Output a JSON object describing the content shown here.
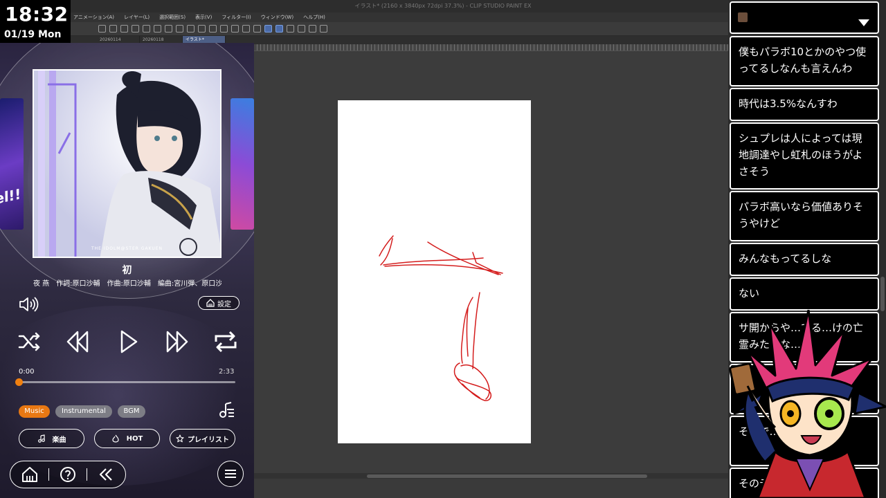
{
  "clock": {
    "time": "18:32",
    "date": "01/19 Mon"
  },
  "csp": {
    "title": "イラスト* (2160 x 3840px 72dpi 37.3%) - CLIP STUDIO PAINT EX",
    "menu": [
      "アニメーション(A)",
      "レイヤー(L)",
      "選択範囲(S)",
      "表示(V)",
      "フィルター(I)",
      "ウィンドウ(W)",
      "ヘルプ(H)"
    ],
    "tabs": [
      "20260114",
      "20260118",
      "イラスト*"
    ],
    "sketch_color": "#d41c1c",
    "paper_color": "#ffffff"
  },
  "player": {
    "song_title": "初",
    "credits": [
      "夜 燕",
      "作詞:原口沙輔",
      "作曲:原口沙輔",
      "編曲:宮川弾、原口沙輔"
    ],
    "album_caption": "THE IDOLM@STER GAKUEN",
    "side_card_text": "el!!",
    "settings_label": "設定",
    "time_current": "0:00",
    "time_total": "2:33",
    "progress": 0.0,
    "chips": {
      "music": "Music",
      "instrumental": "Instrumental",
      "bgm": "BGM"
    },
    "buttons": {
      "songs": "楽曲",
      "hot": "HOT",
      "playlist": "プレイリスト"
    },
    "accent_color": "#e87813"
  },
  "chat": {
    "messages": [
      "僕もパラボ10とかのやつ使ってるしなんも言えんわ",
      "時代は3.5%なんすわ",
      "シュプレは人によっては現地調達やし虹札のほうがよさそう",
      "パラボ高いなら価値ありそうやけど",
      "みんなもってるしな",
      "ない",
      "サ開からや…てる…けの亡霊みたいな…",
      "…",
      "それで…見たら桜…",
      "そのデッキ…"
    ]
  }
}
